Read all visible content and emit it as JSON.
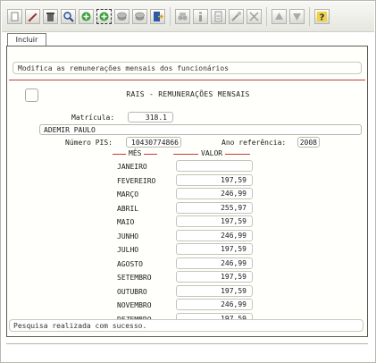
{
  "tab_label": "Incluir",
  "description": "Modifica as remunerações mensais dos funcionários",
  "form_title": "RAIS - REMUNERAÇÕES MENSAIS",
  "matricula": {
    "label": "Matrícula:",
    "value": "318.1"
  },
  "employee_name": "ADEMIR PAULO",
  "pis": {
    "label": "Número PIS:",
    "value": "10430774866"
  },
  "ano_referencia": {
    "label": "Ano referência:",
    "value": "2008"
  },
  "columns": {
    "month": "MÊS",
    "value": "VALOR"
  },
  "months": [
    {
      "name": "JANEIRO",
      "value": ""
    },
    {
      "name": "FEVEREIRO",
      "value": "197,59"
    },
    {
      "name": "MARÇO",
      "value": "246,99"
    },
    {
      "name": "ABRIL",
      "value": "255,97"
    },
    {
      "name": "MAIO",
      "value": "197,59"
    },
    {
      "name": "JUNHO",
      "value": "246,99"
    },
    {
      "name": "JULHO",
      "value": "197,59"
    },
    {
      "name": "AGOSTO",
      "value": "246,99"
    },
    {
      "name": "SETEMBRO",
      "value": "197,59"
    },
    {
      "name": "OUTUBRO",
      "value": "197,59"
    },
    {
      "name": "NOVEMBRO",
      "value": "246,99"
    },
    {
      "name": "DEZEMBRO",
      "value": "197,59"
    }
  ],
  "status_message": "Pesquisa realizada com sucesso.",
  "toolbar_icons": [
    "new-icon",
    "edit-icon",
    "delete-icon",
    "search-icon",
    "add-icon",
    "add-selected-icon",
    "stack-icon",
    "stack-alt-icon",
    "exit-icon",
    "binoculars-icon",
    "info-icon",
    "doc-icon",
    "tool-icon",
    "scissors-icon",
    "up-icon",
    "down-icon",
    "help-icon"
  ],
  "colors": {
    "accent_red": "#c83a3a",
    "help_yellow": "#f2d23a",
    "add_green": "#3aa03a"
  }
}
